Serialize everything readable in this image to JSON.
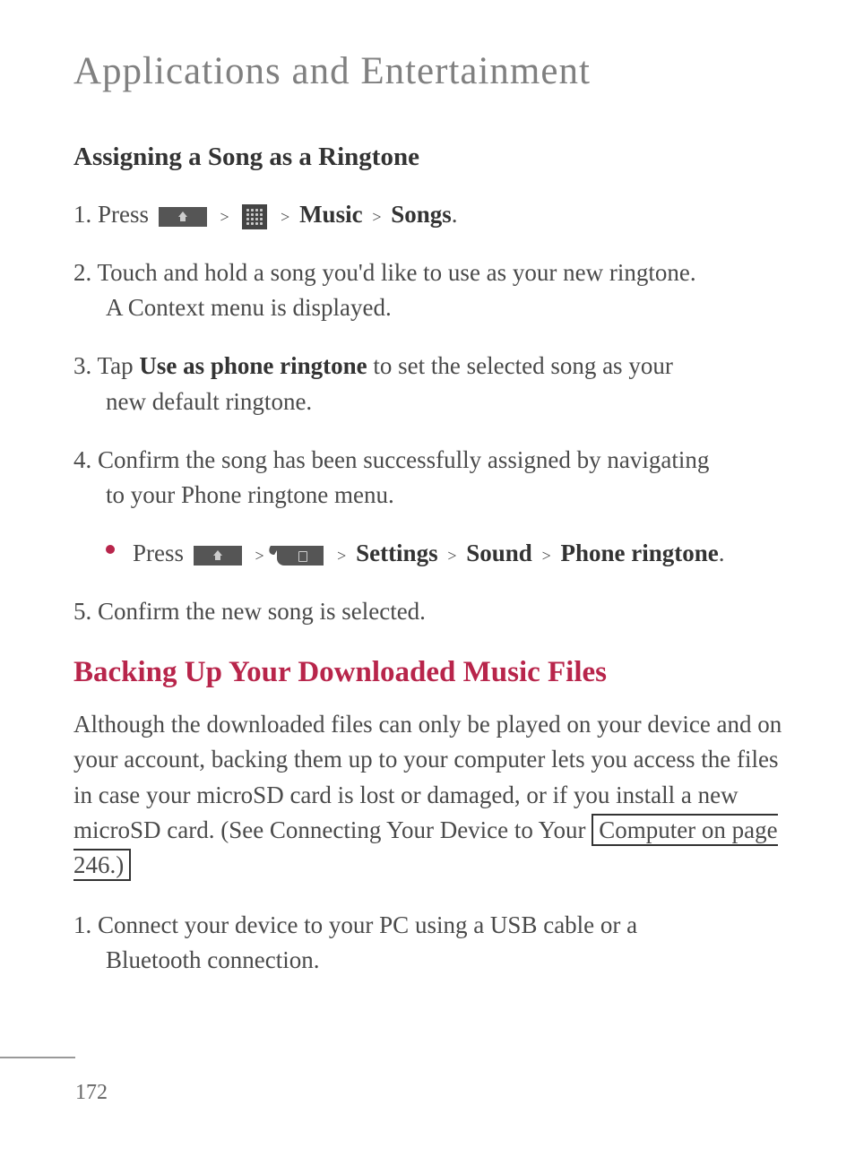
{
  "page_title": "Applications and Entertainment",
  "section1": {
    "heading": "Assigning a Song as a Ringtone",
    "step1_a": "1. Press ",
    "step1_b": "Music",
    "step1_c": "Songs",
    "step2": "2. Touch and hold a song you'd like to use as your new ringtone. A Context menu is displayed.",
    "step3_a": "3. Tap ",
    "step3_b": "Use as phone ringtone",
    "step3_c": " to set the selected song as your new default ringtone.",
    "step4": "4. Confirm the song has been successfully assigned by navigating to your Phone ringtone menu.",
    "bullet_a": "Press ",
    "bullet_b": "Settings",
    "bullet_c": "Sound",
    "bullet_d": "Phone ringtone",
    "step5": "5. Confirm the new song is selected."
  },
  "section2": {
    "heading": "Backing Up Your Downloaded Music Files",
    "para_a": "Although the downloaded  files can only be played on your device and on your account, backing them up to your computer lets you access the files in case your microSD card is lost or damaged, or if you install a new microSD card. (See Connecting Your Device to Your ",
    "para_link": "Computer on page 246.)",
    "step1": "1. Connect your device to your PC using a USB cable or a Bluetooth connection."
  },
  "page_number": "172",
  "gt": ">"
}
